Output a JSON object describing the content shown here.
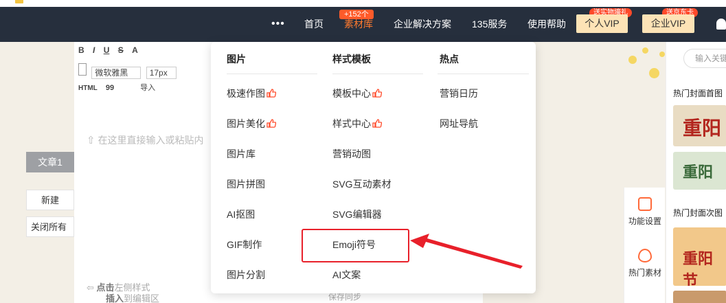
{
  "nav": {
    "more_dots": "•••",
    "items": [
      "首页",
      "素材库",
      "企业解决方案",
      "135服务",
      "使用帮助"
    ],
    "active_badge": "+152个",
    "vip_personal": "个人VIP",
    "vip_personal_tag": "送实物壕礼",
    "vip_enterprise": "企业VIP",
    "vip_enterprise_tag": "送京东卡",
    "accent_color": "#ff7a2e"
  },
  "editor": {
    "toolbar_row1": [
      "B",
      "I",
      "U",
      "S",
      "A"
    ],
    "font_name": "微软雅黑",
    "font_size": "17px",
    "toolbar_row3": [
      "HTML",
      "99",
      "导入"
    ],
    "placeholder": "在这里直接输入或粘贴内",
    "hint_bold1": "点击",
    "hint_text1": "左侧样式",
    "hint_bold2": "插入",
    "hint_text2": "到编辑区",
    "sync_text": "保存同步"
  },
  "left_panel": {
    "doc_tab": "文章1",
    "new_button": "新建",
    "close_all_button": "关闭所有"
  },
  "dropdown": {
    "columns": [
      {
        "heading": "图片",
        "items": [
          {
            "label": "极速作图",
            "thumb": true
          },
          {
            "label": "图片美化",
            "thumb": true
          },
          {
            "label": "图片库",
            "thumb": false
          },
          {
            "label": "图片拼图",
            "thumb": false
          },
          {
            "label": "AI抠图",
            "thumb": false
          },
          {
            "label": "GIF制作",
            "thumb": false
          },
          {
            "label": "图片分割",
            "thumb": false
          }
        ]
      },
      {
        "heading": "样式模板",
        "items": [
          {
            "label": "模板中心",
            "thumb": true
          },
          {
            "label": "样式中心",
            "thumb": true
          },
          {
            "label": "营销动图",
            "thumb": false
          },
          {
            "label": "SVG互动素材",
            "thumb": false
          },
          {
            "label": "SVG编辑器",
            "thumb": false
          },
          {
            "label": "Emoji符号",
            "thumb": false
          },
          {
            "label": "AI文案",
            "thumb": false
          }
        ]
      },
      {
        "heading": "热点",
        "items": [
          {
            "label": "营销日历",
            "thumb": false
          },
          {
            "label": "网址导航",
            "thumb": false
          }
        ]
      }
    ],
    "highlight_color": "#e8202a"
  },
  "tools": {
    "function_settings": "功能设置",
    "hot_material": "热门素材"
  },
  "right_panel": {
    "search_placeholder": "输入关键",
    "hot_cover_first": "热门封面首图",
    "hot_cover_second": "热门封面次图",
    "thumb_word1": "重阳",
    "thumb_word2": "重阳",
    "thumb_word3": "重阳节"
  }
}
